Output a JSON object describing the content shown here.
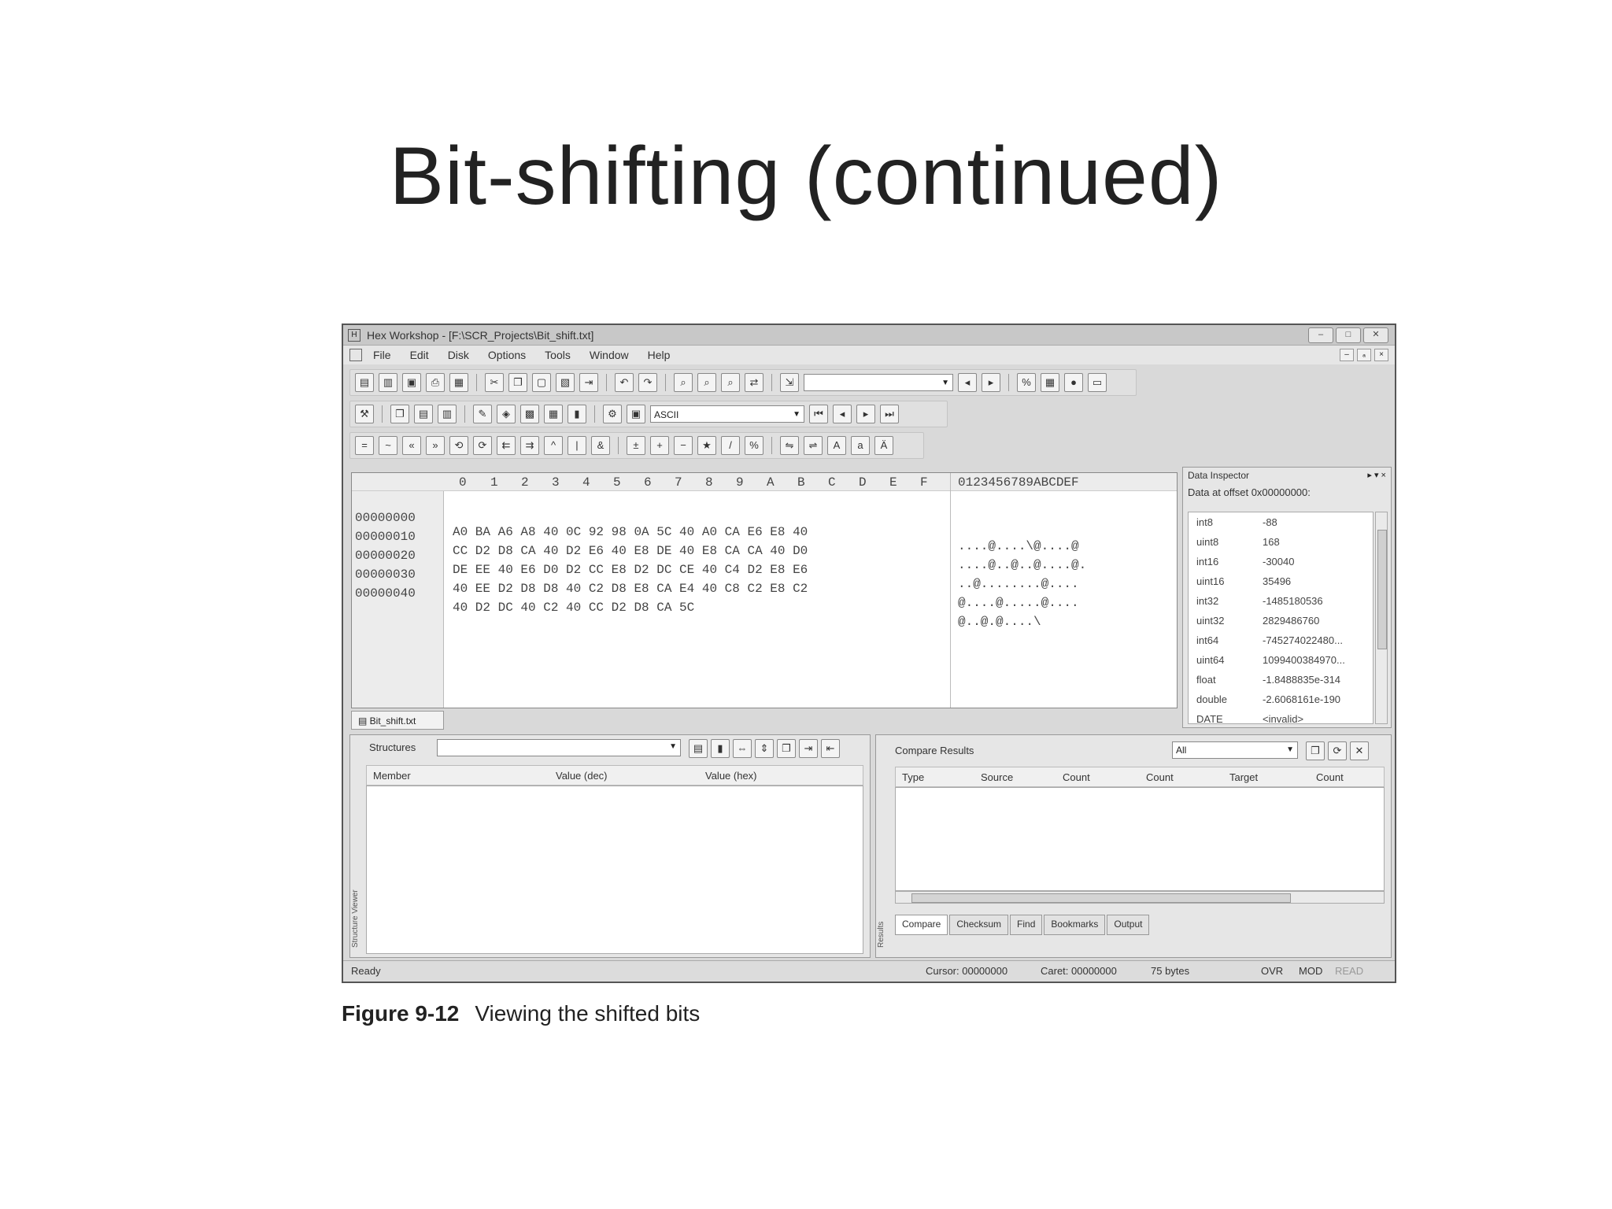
{
  "slide_title": "Bit-shifting (continued)",
  "window": {
    "title": "Hex Workshop - [F:\\SCR_Projects\\Bit_shift.txt]",
    "controls": [
      "–",
      "□",
      "✕"
    ],
    "mdi_controls": [
      "–",
      "ₐ",
      "×"
    ]
  },
  "menu": [
    "File",
    "Edit",
    "Disk",
    "Options",
    "Tools",
    "Window",
    "Help"
  ],
  "toolbar2_combo": "ASCII",
  "hex": {
    "columns": [
      "0",
      "1",
      "2",
      "3",
      "4",
      "5",
      "6",
      "7",
      "8",
      "9",
      "A",
      "B",
      "C",
      "D",
      "E",
      "F"
    ],
    "ascii_header": "0123456789ABCDEF",
    "rows": [
      {
        "offset": "00000000",
        "bytes": "A0 BA A6 A8 40 0C 92 98 0A 5C 40 A0 CA E6 E8 40",
        "ascii": "....@....\\@....@"
      },
      {
        "offset": "00000010",
        "bytes": "CC D2 D8 CA 40 D2 E6 40 E8 DE 40 E8 CA CA 40 D0",
        "ascii": "....@..@..@....@."
      },
      {
        "offset": "00000020",
        "bytes": "DE EE 40 E6 D0 D2 CC E8 D2 DC CE 40 C4 D2 E8 E6",
        "ascii": "..@........@...."
      },
      {
        "offset": "00000030",
        "bytes": "40 EE D2 D8 D8 40 C2 D8 E8 CA E4 40 C8 C2 E8 C2",
        "ascii": "@....@.....@...."
      },
      {
        "offset": "00000040",
        "bytes": "40 D2 DC 40 C2 40 CC D2 D8 CA 5C",
        "ascii": "@..@.@....\\"
      }
    ]
  },
  "file_tab": "Bit_shift.txt",
  "inspector": {
    "title": "Data Inspector",
    "pins": "▸ ▾ ×",
    "offset_label": "Data at offset 0x00000000:",
    "rows": [
      {
        "type": "int8",
        "value": "-88"
      },
      {
        "type": "uint8",
        "value": "168"
      },
      {
        "type": "int16",
        "value": "-30040"
      },
      {
        "type": "uint16",
        "value": "35496"
      },
      {
        "type": "int32",
        "value": "-1485180536"
      },
      {
        "type": "uint32",
        "value": "2829486760"
      },
      {
        "type": "int64",
        "value": "-745274022480..."
      },
      {
        "type": "uint64",
        "value": "1099400384970..."
      },
      {
        "type": "float",
        "value": "-1.8488835e-314"
      },
      {
        "type": "double",
        "value": "-2.6068161e-190"
      },
      {
        "type": "DATE",
        "value": "<invalid>"
      }
    ]
  },
  "structures": {
    "title": "Structures",
    "side_label": "Structure Viewer",
    "columns": [
      "Member",
      "Value (dec)",
      "Value (hex)"
    ]
  },
  "results": {
    "title": "Compare Results",
    "side_label": "Results",
    "filter": "All",
    "columns": [
      "Type",
      "Source",
      "Count",
      "Count",
      "Target",
      "Count"
    ],
    "tabs": [
      "Compare",
      "Checksum",
      "Find",
      "Bookmarks",
      "Output"
    ]
  },
  "status": {
    "ready": "Ready",
    "cursor": "Cursor: 00000000",
    "caret": "Caret: 00000000",
    "size": "75 bytes",
    "ovr": "OVR",
    "mod": "MOD",
    "read": "READ"
  },
  "caption": {
    "number": "Figure 9-12",
    "text": "Viewing the shifted bits"
  }
}
